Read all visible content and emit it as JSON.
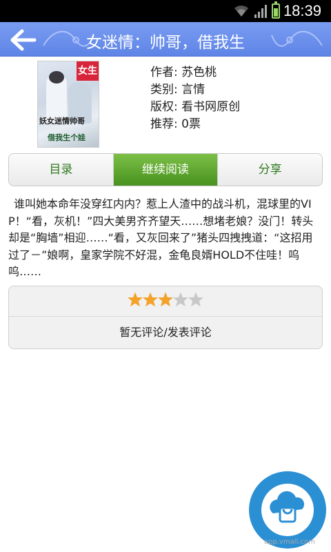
{
  "status_bar": {
    "time": "18:39",
    "icons": [
      "wifi-icon",
      "signal-icon",
      "battery-icon"
    ]
  },
  "header": {
    "title": "女迷情：帅哥，借我生",
    "back_icon": "back-arrow-icon"
  },
  "book": {
    "cover": {
      "tag": "女生",
      "title_line1": "妖女迷情帅哥",
      "title_line2": "借我生个娃"
    },
    "author": "作者: 苏色桃",
    "category": "类别: 言情",
    "copyright": "版权: 看书网原创",
    "recommend": "推荐: 0票"
  },
  "tabs": [
    {
      "label": "目录",
      "active": false
    },
    {
      "label": "继续阅读",
      "active": true
    },
    {
      "label": "分享",
      "active": false
    }
  ],
  "description": "谁叫她本命年没穿红内内？惹上人渣中的战斗机，混球里的VIP！“看，灰机！”四大美男齐齐望天……想堵老娘？没门！转头却是“胸墙”相迎……“看，又灰回来了”猪头四拽拽道：“这招用过了－”娘啊，皇家学院不好混，金龟良婿HOLD不住哇！呜呜……",
  "review": {
    "rating": 3,
    "max_rating": 5,
    "comment_label": "暂无评论/发表评论"
  },
  "watermark": {
    "badge_text": "智汇云应用市场",
    "url": "app.vmall.com"
  },
  "colors": {
    "header": "#6a8fec",
    "accent_green": "#5aa22e",
    "star_on": "#f3a22a",
    "star_off": "#c8c8c8"
  }
}
